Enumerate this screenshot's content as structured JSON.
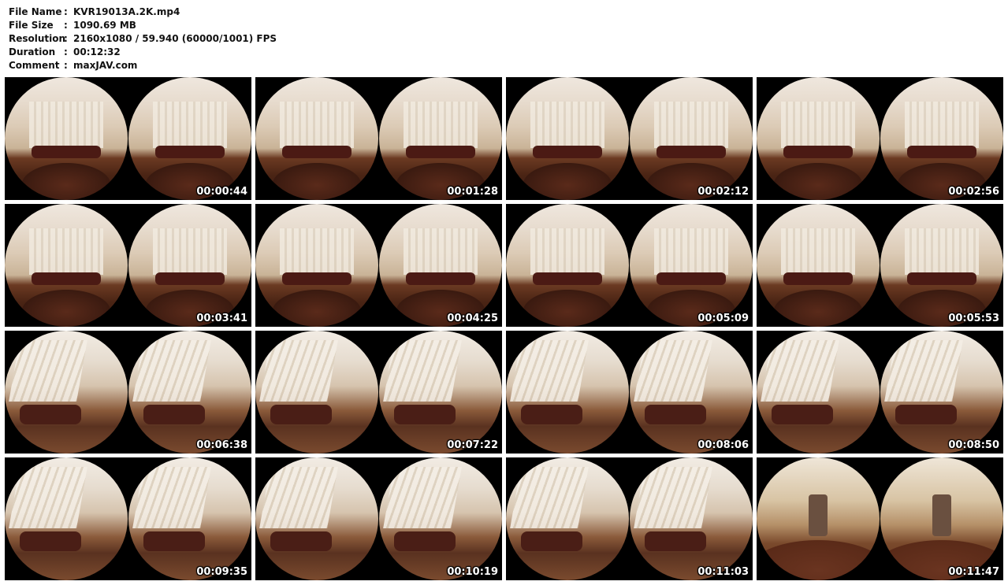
{
  "info": [
    {
      "label": "File Name",
      "sep": ":",
      "value": "KVR19013A.2K.mp4"
    },
    {
      "label": "File Size",
      "sep": ":",
      "value": "1090.69 MB"
    },
    {
      "label": "Resolution",
      "sep": ":",
      "value": "2160x1080 / 59.940 (60000/1001) FPS"
    },
    {
      "label": "Duration",
      "sep": ":",
      "value": "00:12:32"
    },
    {
      "label": "Comment",
      "sep": ":",
      "value": "maxJAV.com"
    }
  ],
  "thumbnails": [
    {
      "timestamp": "00:00:44",
      "scene": "room"
    },
    {
      "timestamp": "00:01:28",
      "scene": "room"
    },
    {
      "timestamp": "00:02:12",
      "scene": "room"
    },
    {
      "timestamp": "00:02:56",
      "scene": "room"
    },
    {
      "timestamp": "00:03:41",
      "scene": "room"
    },
    {
      "timestamp": "00:04:25",
      "scene": "room"
    },
    {
      "timestamp": "00:05:09",
      "scene": "room"
    },
    {
      "timestamp": "00:05:53",
      "scene": "room"
    },
    {
      "timestamp": "00:06:38",
      "scene": "close"
    },
    {
      "timestamp": "00:07:22",
      "scene": "close"
    },
    {
      "timestamp": "00:08:06",
      "scene": "close"
    },
    {
      "timestamp": "00:08:50",
      "scene": "close"
    },
    {
      "timestamp": "00:09:35",
      "scene": "close"
    },
    {
      "timestamp": "00:10:19",
      "scene": "close"
    },
    {
      "timestamp": "00:11:03",
      "scene": "close"
    },
    {
      "timestamp": "00:11:47",
      "scene": "spa"
    }
  ]
}
